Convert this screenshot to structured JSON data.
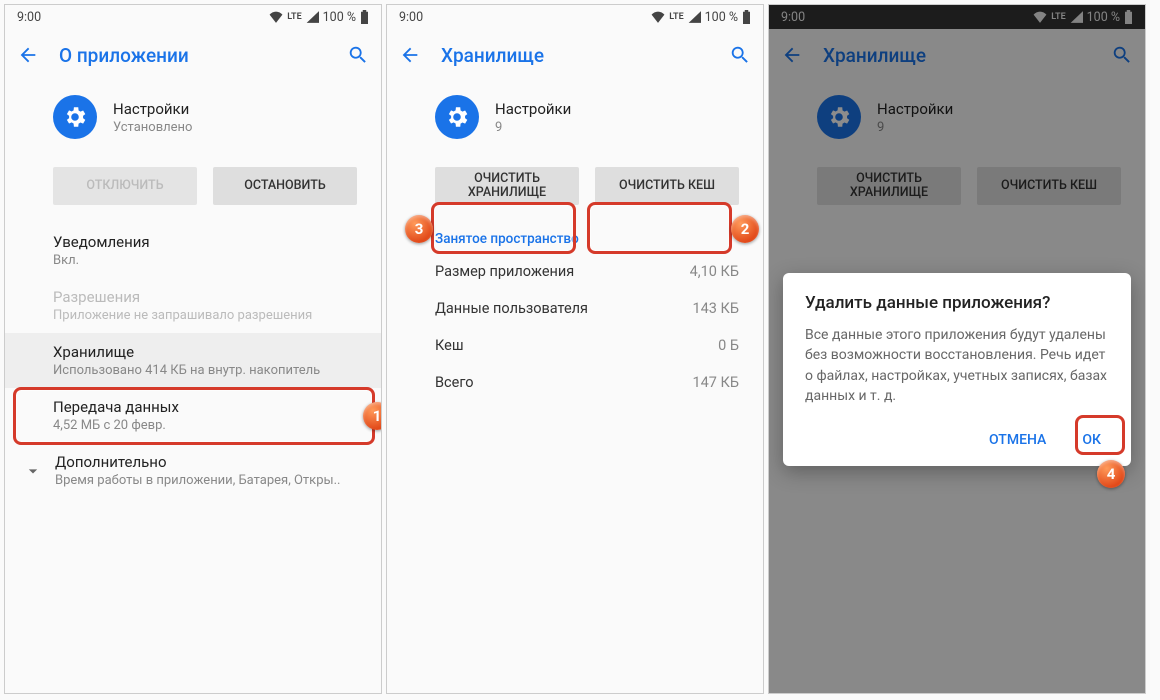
{
  "status": {
    "time": "9:00",
    "battery": "100 %",
    "net": "LTE"
  },
  "screen1": {
    "title": "О приложении",
    "app_name": "Настройки",
    "app_sub": "Установлено",
    "btn_disable": "ОТКЛЮЧИТЬ",
    "btn_stop": "ОСТАНОВИТЬ",
    "notifications": {
      "lbl": "Уведомления",
      "sub": "Вкл."
    },
    "permissions": {
      "lbl": "Разрешения",
      "sub": "Приложение не запрашивало разрешения"
    },
    "storage": {
      "lbl": "Хранилище",
      "sub": "Использовано 414 КБ на внутр. накопитель"
    },
    "data": {
      "lbl": "Передача данных",
      "sub": "4,52 МБ с 20 февр."
    },
    "more": {
      "lbl": "Дополнительно",
      "sub": "Время работы в приложении, Батарея, Откры.."
    }
  },
  "screen2": {
    "title": "Хранилище",
    "app_name": "Настройки",
    "app_sub": "9",
    "btn_clear_storage": "ОЧИСТИТЬ ХРАНИЛИЩЕ",
    "btn_clear_cache": "ОЧИСТИТЬ КЕШ",
    "section": "Занятое пространство",
    "rows": [
      {
        "k": "Размер приложения",
        "v": "4,10 КБ"
      },
      {
        "k": "Данные пользователя",
        "v": "143 КБ"
      },
      {
        "k": "Кеш",
        "v": "0 Б"
      },
      {
        "k": "Всего",
        "v": "147 КБ"
      }
    ]
  },
  "screen3": {
    "title": "Хранилище",
    "app_name": "Настройки",
    "app_sub": "9",
    "btn_clear_storage": "ОЧИСТИТЬ ХРАНИЛИЩЕ",
    "btn_clear_cache": "ОЧИСТИТЬ КЕШ",
    "dialog": {
      "title": "Удалить данные приложения?",
      "text": "Все данные этого приложения будут удалены без возможности восстановления. Речь идет о файлах, настройках, учетных записях, базах данных и т. д.",
      "cancel": "ОТМЕНА",
      "ok": "ОК"
    }
  },
  "badges": {
    "b1": "1",
    "b2": "2",
    "b3": "3",
    "b4": "4"
  }
}
